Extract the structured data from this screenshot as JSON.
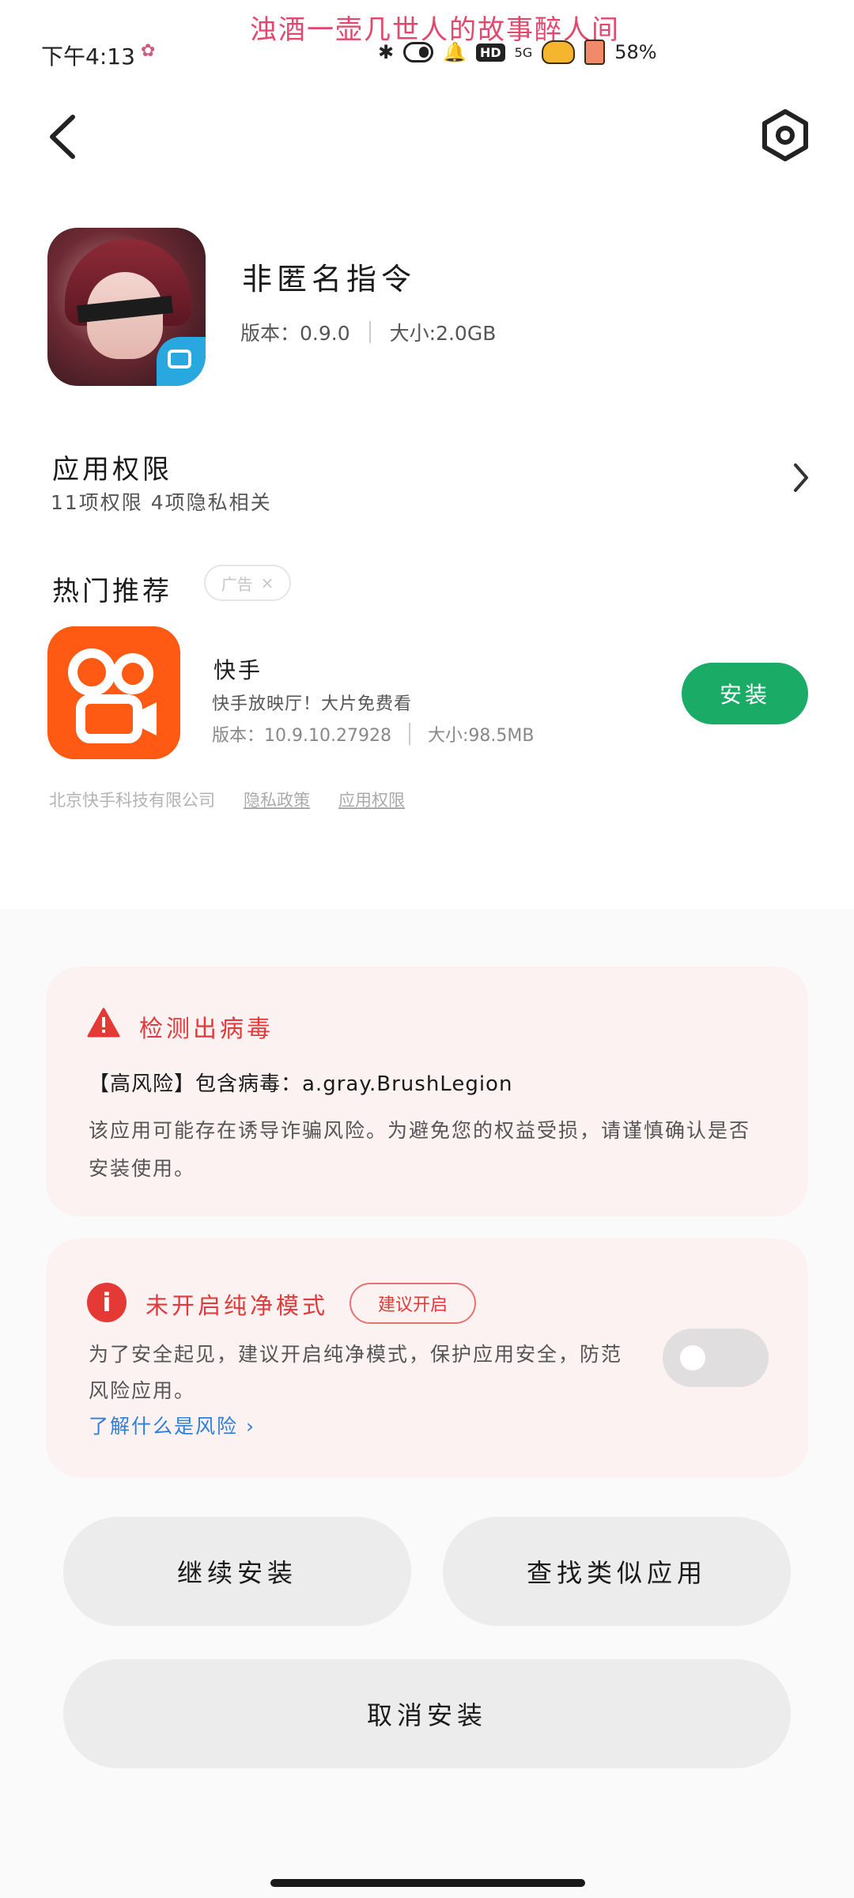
{
  "status_bar": {
    "time": "下午4:13",
    "slogan": "浊酒一壶几世人的故事醉人间",
    "network": "5G",
    "hd_badge": "HD",
    "battery": "58%"
  },
  "top_bar": {
    "back_icon": "chevron-left-icon",
    "settings_icon": "settings-hexagon-icon"
  },
  "app": {
    "name": "非匿名指令",
    "version_label": "版本：",
    "version": "0.9.0",
    "size_label": "大小:",
    "size": "2.0GB"
  },
  "permissions": {
    "title": "应用权限",
    "summary": "11项权限 4项隐私相关"
  },
  "recommend": {
    "title": "热门推荐",
    "ad_label": "广告",
    "app_name": "快手",
    "app_desc": "快手放映厅！大片免费看",
    "version_label": "版本：",
    "version": "10.9.10.27928",
    "size_label": "大小:",
    "size": "98.5MB",
    "install_label": "安装",
    "developer": "北京快手科技有限公司",
    "privacy_link": "隐私政策",
    "permission_link": "应用权限",
    "brand_color": "#FF5A14",
    "install_color": "#1AAB66"
  },
  "virus": {
    "title": "检测出病毒",
    "risk_line": "【高风险】包含病毒：a.gray.BrushLegion",
    "body": "该应用可能存在诱导诈骗风险。为避免您的权益受损，请谨慎确认是否安装使用。",
    "accent_color": "#E03A3A"
  },
  "pure_mode": {
    "title": "未开启纯净模式",
    "suggest_label": "建议开启",
    "body": "为了安全起见，建议开启纯净模式，保护应用安全，防范风险应用。",
    "link": "了解什么是风险",
    "toggle_on": false
  },
  "actions": {
    "continue_label": "继续安装",
    "similar_label": "查找类似应用",
    "cancel_label": "取消安装"
  }
}
